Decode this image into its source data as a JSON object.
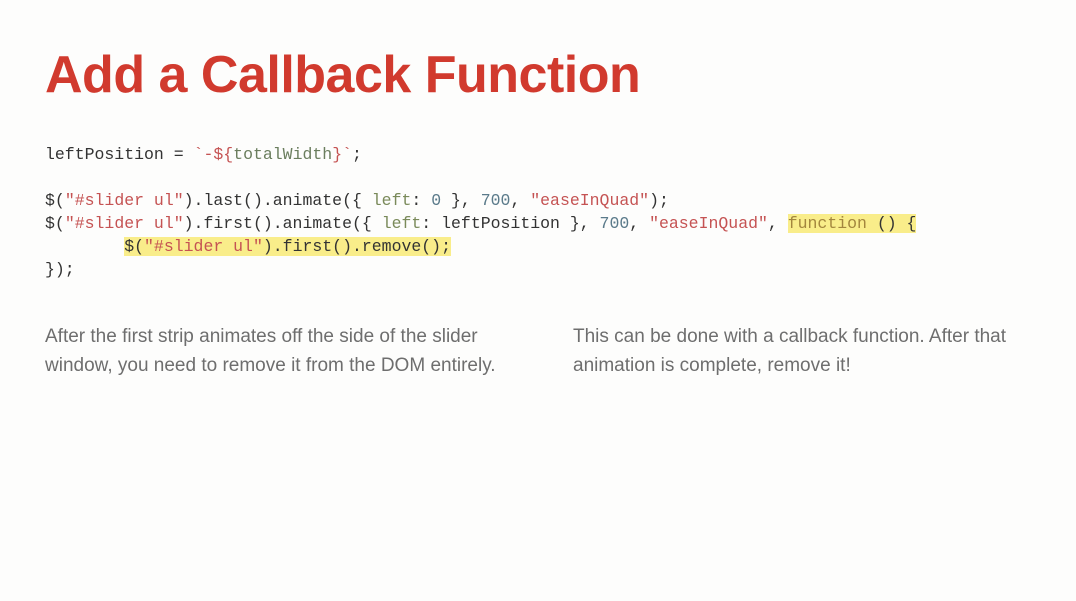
{
  "title": "Add a Callback Function",
  "code": {
    "line1": {
      "var": "leftPosition",
      "eq": " = ",
      "backtick_open": "`",
      "tmpl_open": "-${",
      "tmpl_var": "totalWidth",
      "tmpl_close": "}",
      "backtick_close": "`",
      "semicolon": ";"
    },
    "line3": {
      "jq": "$(",
      "selector": "\"#slider ul\"",
      "chain1": ").last().animate({ ",
      "prop": "left",
      "colon": ": ",
      "val": "0",
      "chain2": " }, ",
      "duration": "700",
      "comma": ", ",
      "easing": "\"easeInQuad\"",
      "end": ");"
    },
    "line4": {
      "jq": "$(",
      "selector": "\"#slider ul\"",
      "chain1": ").first().animate({ ",
      "prop": "left",
      "colon": ": ",
      "val": "leftPosition",
      "chain2": " }, ",
      "duration": "700",
      "comma": ", ",
      "easing": "\"easeInQuad\"",
      "comma2": ", ",
      "hl_func": "function",
      "hl_rest": " () {"
    },
    "line5": {
      "indent": "        ",
      "jq": "$(",
      "selector": "\"#slider ul\"",
      "chain": ").first().remove();"
    },
    "line6": {
      "text": "});"
    }
  },
  "columns": {
    "left": "After the first strip animates off the side of the slider window, you need to remove it from the DOM entirely.",
    "right": "This can be done with a callback function. After that animation is complete, remove it!"
  }
}
